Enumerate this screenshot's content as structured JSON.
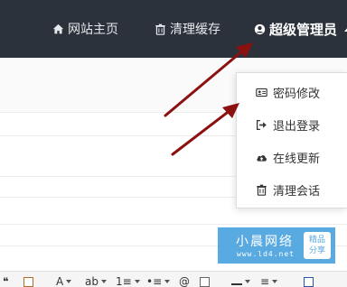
{
  "nav": {
    "home_label": "网站主页",
    "cache_label": "清理缓存",
    "admin_label": "超级管理员"
  },
  "dropdown": {
    "items": [
      {
        "label": "密码修改",
        "icon": "id-card-icon"
      },
      {
        "label": "退出登录",
        "icon": "sign-out-icon"
      },
      {
        "label": "在线更新",
        "icon": "cloud-upload-icon"
      },
      {
        "label": "清理会话",
        "icon": "trash-icon"
      }
    ]
  },
  "watermark": {
    "title": "小晨网络",
    "url": "www.ld4.net",
    "seal_line1": "精品",
    "seal_line2": "分享"
  },
  "toolbar": {
    "quote_glyph": "❝",
    "font_color_label": "A",
    "highlight_label": "ab",
    "ordered_list_label": "1≡",
    "unordered_list_label": "•≡",
    "anchor_label": "@",
    "indent_label": "≡"
  },
  "colors": {
    "topbar_bg": "#2c323b",
    "arrow": "#8b1010",
    "watermark_bg": "#4aa3df"
  }
}
